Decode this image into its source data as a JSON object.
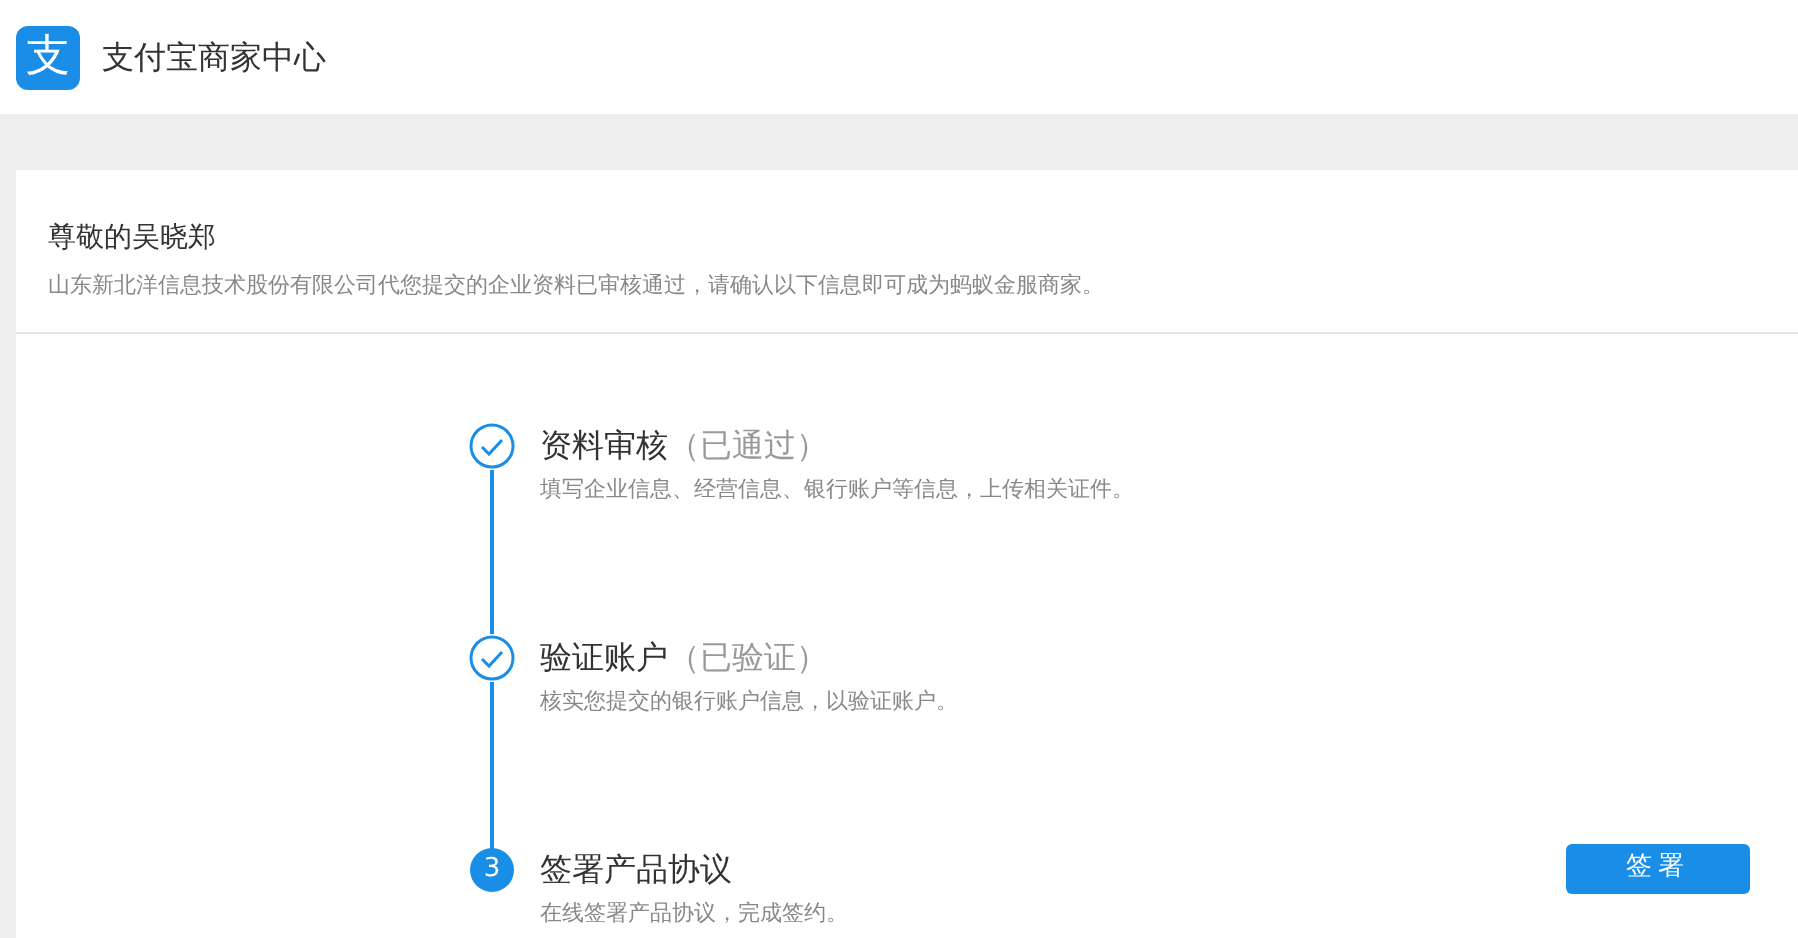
{
  "header": {
    "logo_char": "支",
    "title": "支付宝商家中心"
  },
  "greeting": {
    "title": "尊敬的吴晓郑",
    "message": "山东新北洋信息技术股份有限公司代您提交的企业资料已审核通过，请确认以下信息即可成为蚂蚁金服商家。"
  },
  "steps": [
    {
      "kind": "done",
      "title": "资料审核",
      "status_text": "（已通过）",
      "description": "填写企业信息、经营信息、银行账户等信息，上传相关证件。"
    },
    {
      "kind": "done",
      "title": "验证账户",
      "status_text": "（已验证）",
      "description": "核实您提交的银行账户信息，以验证账户。"
    },
    {
      "kind": "current",
      "number": "3",
      "title": "签署产品协议",
      "description": "在线签署产品协议，完成签约。",
      "action": "签署"
    }
  ]
}
